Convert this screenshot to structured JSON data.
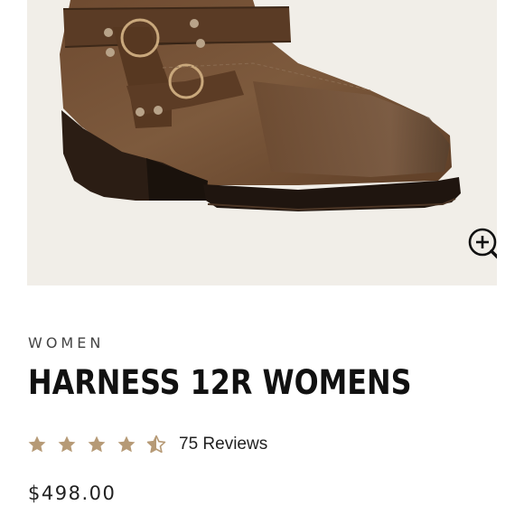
{
  "product": {
    "category": "WOMEN",
    "title": "HARNESS 12R WOMENS",
    "rating_value": 4.5,
    "rating_max": 5,
    "reviews_label": "75 Reviews",
    "price": "$498.00"
  },
  "image": {
    "subject_icon": "boot-image",
    "zoom_icon": "zoom-in-icon"
  },
  "colors": {
    "image_background": "#f1eee8",
    "star": "#b69a76",
    "title": "#111111"
  }
}
